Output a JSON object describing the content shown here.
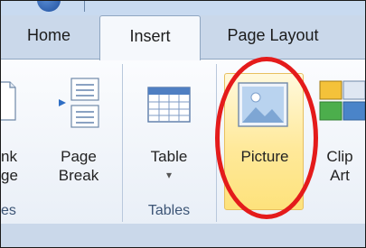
{
  "tabs": [
    {
      "label": "Home"
    },
    {
      "label": "Insert"
    },
    {
      "label": "Page Layout"
    }
  ],
  "buttons": {
    "blank_page": {
      "line1": "nk",
      "line2": "ge"
    },
    "page_break": {
      "line1": "Page",
      "line2": "Break"
    },
    "table": {
      "label": "Table",
      "dropdown": "▾"
    },
    "picture": {
      "label": "Picture"
    },
    "clip_art": {
      "line1": "Clip",
      "line2": "Art"
    }
  },
  "groups": {
    "pages": "es",
    "tables": "Tables"
  },
  "icons": {
    "quick_access": "office-orb-icon",
    "blank_page": "blank-page-icon",
    "page_break": "page-break-icon",
    "table": "table-grid-icon",
    "picture": "picture-landscape-icon",
    "clip_art": "clip-art-icon"
  },
  "colors": {
    "accent_highlight": "#ffe99a",
    "annotation_circle": "#e41b1b"
  }
}
